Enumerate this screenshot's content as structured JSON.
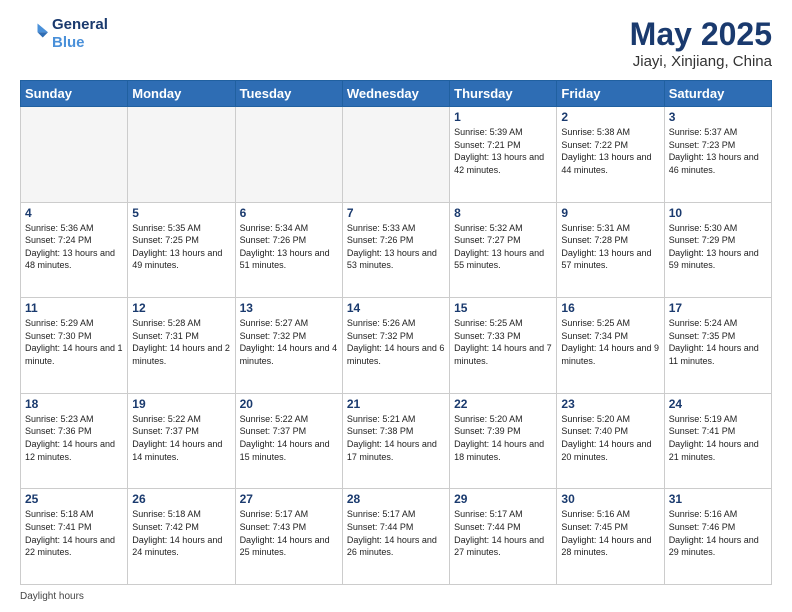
{
  "logo": {
    "line1": "General",
    "line2": "Blue"
  },
  "title": "May 2025",
  "subtitle": "Jiayi, Xinjiang, China",
  "header_days": [
    "Sunday",
    "Monday",
    "Tuesday",
    "Wednesday",
    "Thursday",
    "Friday",
    "Saturday"
  ],
  "footer": "Daylight hours",
  "weeks": [
    [
      {
        "day": "",
        "info": ""
      },
      {
        "day": "",
        "info": ""
      },
      {
        "day": "",
        "info": ""
      },
      {
        "day": "",
        "info": ""
      },
      {
        "day": "1",
        "info": "Sunrise: 5:39 AM\nSunset: 7:21 PM\nDaylight: 13 hours\nand 42 minutes."
      },
      {
        "day": "2",
        "info": "Sunrise: 5:38 AM\nSunset: 7:22 PM\nDaylight: 13 hours\nand 44 minutes."
      },
      {
        "day": "3",
        "info": "Sunrise: 5:37 AM\nSunset: 7:23 PM\nDaylight: 13 hours\nand 46 minutes."
      }
    ],
    [
      {
        "day": "4",
        "info": "Sunrise: 5:36 AM\nSunset: 7:24 PM\nDaylight: 13 hours\nand 48 minutes."
      },
      {
        "day": "5",
        "info": "Sunrise: 5:35 AM\nSunset: 7:25 PM\nDaylight: 13 hours\nand 49 minutes."
      },
      {
        "day": "6",
        "info": "Sunrise: 5:34 AM\nSunset: 7:26 PM\nDaylight: 13 hours\nand 51 minutes."
      },
      {
        "day": "7",
        "info": "Sunrise: 5:33 AM\nSunset: 7:26 PM\nDaylight: 13 hours\nand 53 minutes."
      },
      {
        "day": "8",
        "info": "Sunrise: 5:32 AM\nSunset: 7:27 PM\nDaylight: 13 hours\nand 55 minutes."
      },
      {
        "day": "9",
        "info": "Sunrise: 5:31 AM\nSunset: 7:28 PM\nDaylight: 13 hours\nand 57 minutes."
      },
      {
        "day": "10",
        "info": "Sunrise: 5:30 AM\nSunset: 7:29 PM\nDaylight: 13 hours\nand 59 minutes."
      }
    ],
    [
      {
        "day": "11",
        "info": "Sunrise: 5:29 AM\nSunset: 7:30 PM\nDaylight: 14 hours\nand 1 minute."
      },
      {
        "day": "12",
        "info": "Sunrise: 5:28 AM\nSunset: 7:31 PM\nDaylight: 14 hours\nand 2 minutes."
      },
      {
        "day": "13",
        "info": "Sunrise: 5:27 AM\nSunset: 7:32 PM\nDaylight: 14 hours\nand 4 minutes."
      },
      {
        "day": "14",
        "info": "Sunrise: 5:26 AM\nSunset: 7:32 PM\nDaylight: 14 hours\nand 6 minutes."
      },
      {
        "day": "15",
        "info": "Sunrise: 5:25 AM\nSunset: 7:33 PM\nDaylight: 14 hours\nand 7 minutes."
      },
      {
        "day": "16",
        "info": "Sunrise: 5:25 AM\nSunset: 7:34 PM\nDaylight: 14 hours\nand 9 minutes."
      },
      {
        "day": "17",
        "info": "Sunrise: 5:24 AM\nSunset: 7:35 PM\nDaylight: 14 hours\nand 11 minutes."
      }
    ],
    [
      {
        "day": "18",
        "info": "Sunrise: 5:23 AM\nSunset: 7:36 PM\nDaylight: 14 hours\nand 12 minutes."
      },
      {
        "day": "19",
        "info": "Sunrise: 5:22 AM\nSunset: 7:37 PM\nDaylight: 14 hours\nand 14 minutes."
      },
      {
        "day": "20",
        "info": "Sunrise: 5:22 AM\nSunset: 7:37 PM\nDaylight: 14 hours\nand 15 minutes."
      },
      {
        "day": "21",
        "info": "Sunrise: 5:21 AM\nSunset: 7:38 PM\nDaylight: 14 hours\nand 17 minutes."
      },
      {
        "day": "22",
        "info": "Sunrise: 5:20 AM\nSunset: 7:39 PM\nDaylight: 14 hours\nand 18 minutes."
      },
      {
        "day": "23",
        "info": "Sunrise: 5:20 AM\nSunset: 7:40 PM\nDaylight: 14 hours\nand 20 minutes."
      },
      {
        "day": "24",
        "info": "Sunrise: 5:19 AM\nSunset: 7:41 PM\nDaylight: 14 hours\nand 21 minutes."
      }
    ],
    [
      {
        "day": "25",
        "info": "Sunrise: 5:18 AM\nSunset: 7:41 PM\nDaylight: 14 hours\nand 22 minutes."
      },
      {
        "day": "26",
        "info": "Sunrise: 5:18 AM\nSunset: 7:42 PM\nDaylight: 14 hours\nand 24 minutes."
      },
      {
        "day": "27",
        "info": "Sunrise: 5:17 AM\nSunset: 7:43 PM\nDaylight: 14 hours\nand 25 minutes."
      },
      {
        "day": "28",
        "info": "Sunrise: 5:17 AM\nSunset: 7:44 PM\nDaylight: 14 hours\nand 26 minutes."
      },
      {
        "day": "29",
        "info": "Sunrise: 5:17 AM\nSunset: 7:44 PM\nDaylight: 14 hours\nand 27 minutes."
      },
      {
        "day": "30",
        "info": "Sunrise: 5:16 AM\nSunset: 7:45 PM\nDaylight: 14 hours\nand 28 minutes."
      },
      {
        "day": "31",
        "info": "Sunrise: 5:16 AM\nSunset: 7:46 PM\nDaylight: 14 hours\nand 29 minutes."
      }
    ]
  ]
}
